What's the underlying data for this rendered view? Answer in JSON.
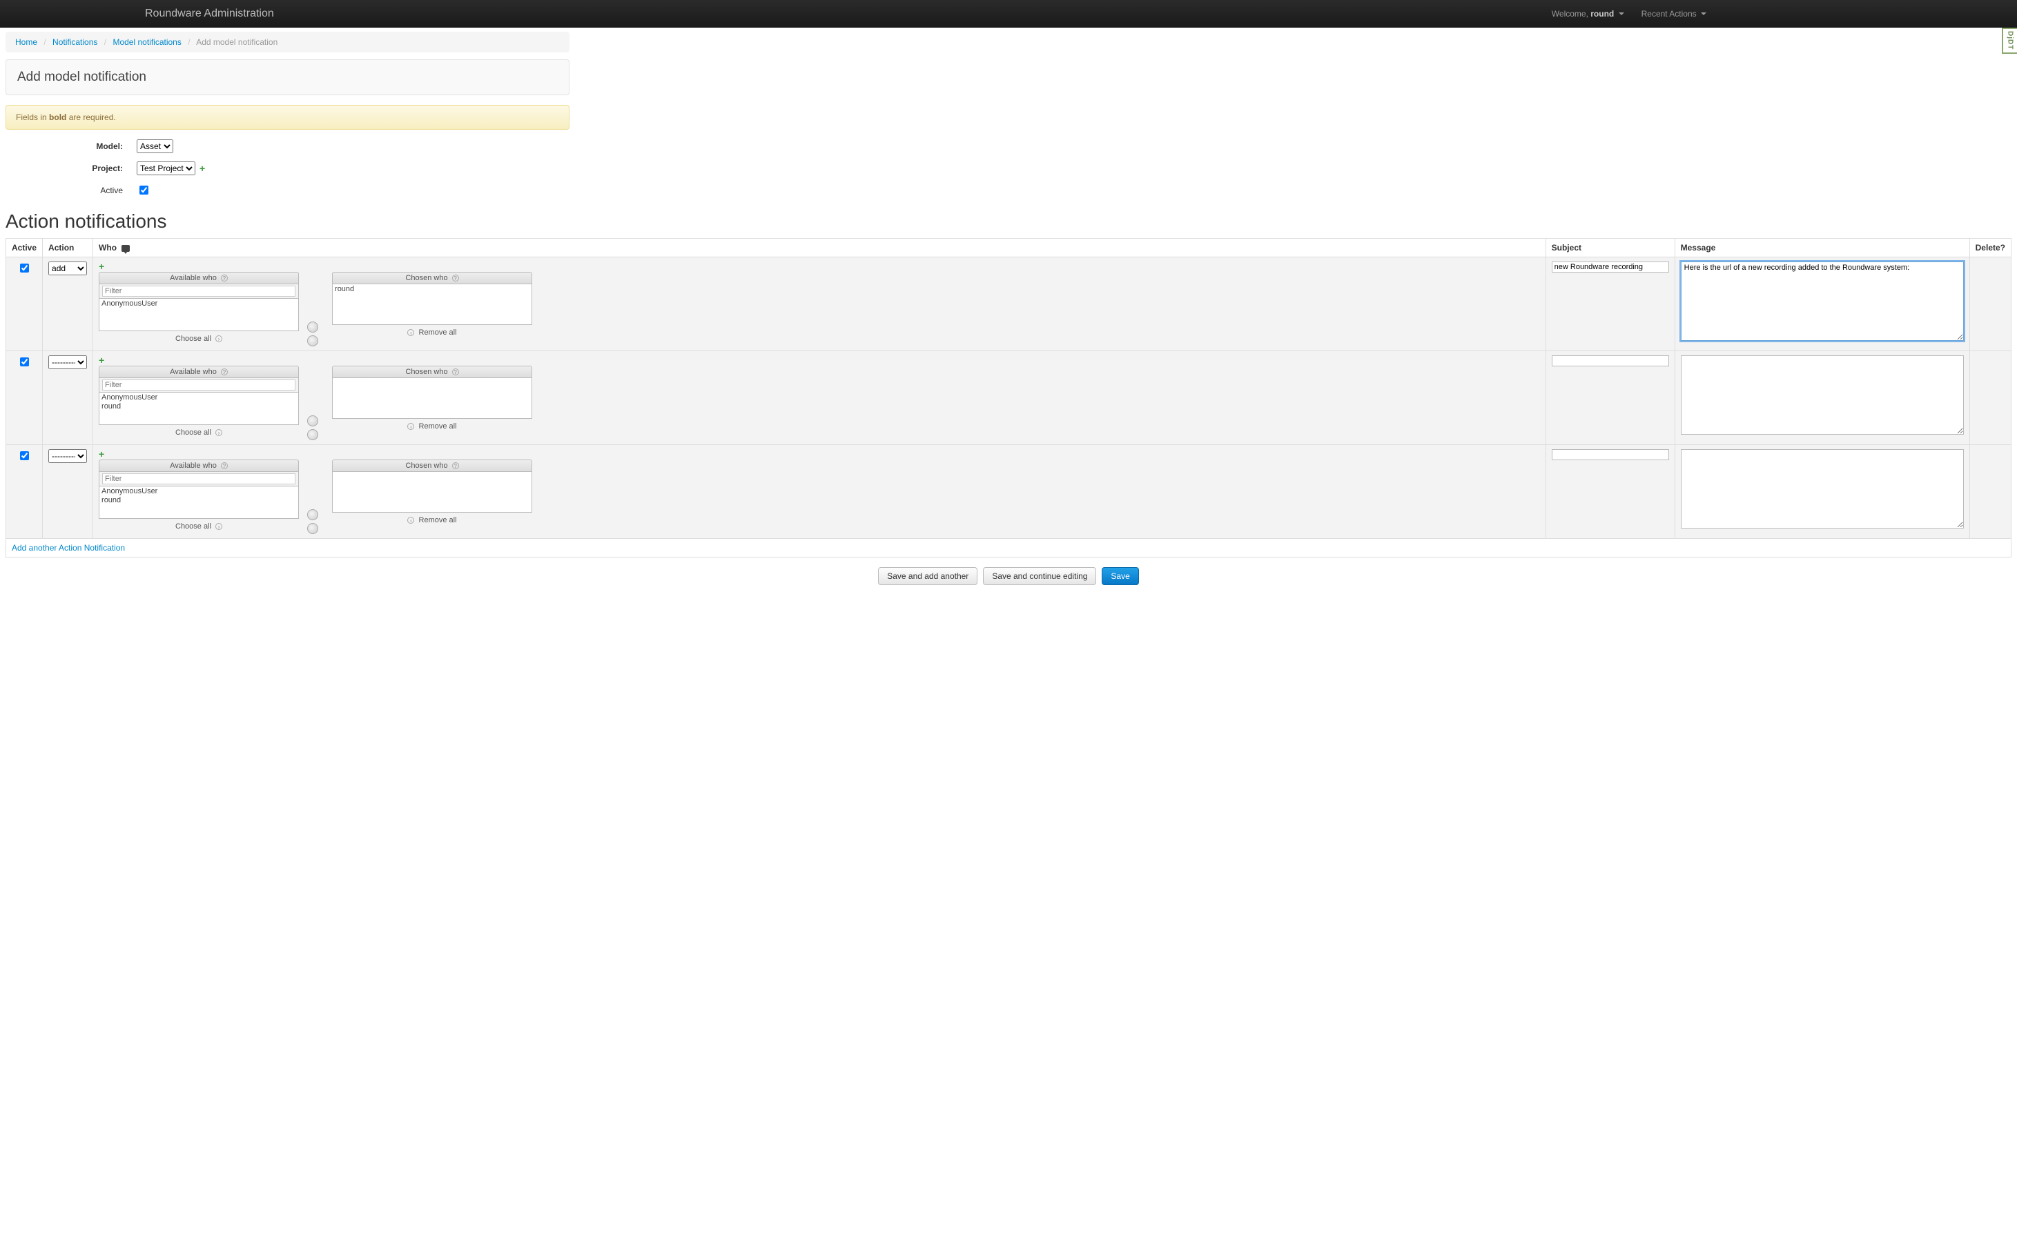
{
  "navbar": {
    "brand": "Roundware Administration",
    "welcome_prefix": "Welcome, ",
    "username": "round",
    "recent_actions": "Recent Actions"
  },
  "breadcrumb": {
    "home": "Home",
    "notifications": "Notifications",
    "model_notifications": "Model notifications",
    "current": "Add model notification"
  },
  "page_header": "Add model notification",
  "alert": {
    "pre": "Fields in ",
    "bold": "bold",
    "post": " are required."
  },
  "form": {
    "model_label": "Model:",
    "model_value": "Asset",
    "project_label": "Project:",
    "project_value": "Test Project",
    "active_label": "Active"
  },
  "inline": {
    "title": "Action notifications",
    "headers": {
      "active": "Active",
      "action": "Action",
      "who": "Who",
      "subject": "Subject",
      "message": "Message",
      "delete": "Delete?"
    },
    "selector_labels": {
      "available": "Available who",
      "chosen": "Chosen who",
      "filter_placeholder": "Filter",
      "choose_all": "Choose all",
      "remove_all": "Remove all"
    },
    "rows": [
      {
        "active": true,
        "action": "add",
        "available": [
          "AnonymousUser"
        ],
        "chosen": [
          "round"
        ],
        "subject": "new Roundware recording",
        "message": "Here is the url of a new recording added to the Roundware system:\n\n",
        "focused": true
      },
      {
        "active": true,
        "action": "---------",
        "available": [
          "AnonymousUser",
          "round"
        ],
        "chosen": [],
        "subject": "",
        "message": "",
        "focused": false
      },
      {
        "active": true,
        "action": "---------",
        "available": [
          "AnonymousUser",
          "round"
        ],
        "chosen": [],
        "subject": "",
        "message": "",
        "focused": false
      }
    ],
    "add_another": "Add another Action Notification"
  },
  "buttons": {
    "save_add": "Save and add another",
    "save_continue": "Save and continue editing",
    "save": "Save"
  },
  "djdt": "DjDT"
}
